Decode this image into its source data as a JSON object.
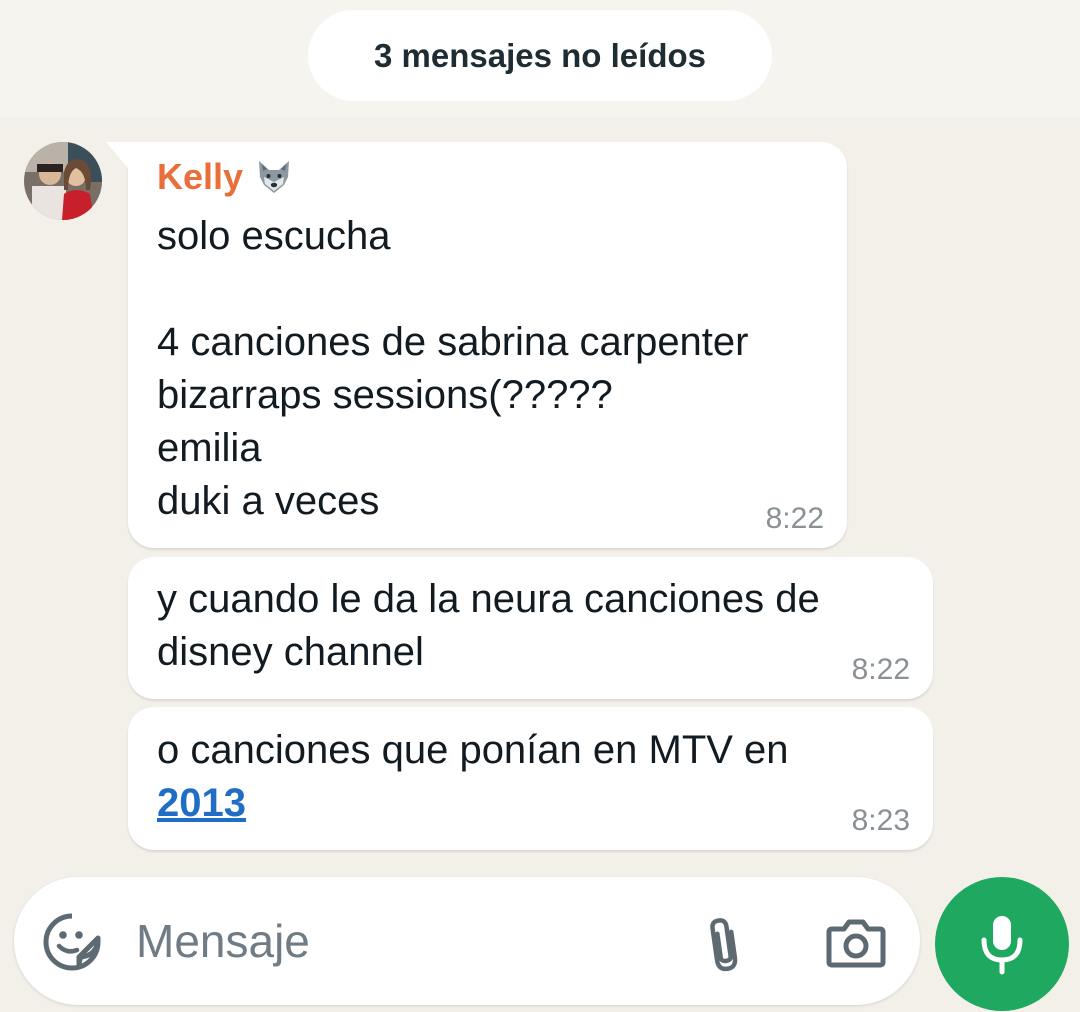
{
  "unread_banner": {
    "text": "3 mensajes no leídos"
  },
  "colors": {
    "chat_background": "#f3f0ea",
    "sender_name": "#e86f3a",
    "link": "#1f6dc4",
    "mic_button": "#1fa85f",
    "bubble": "#ffffff"
  },
  "messages": [
    {
      "sender": "Kelly",
      "sender_emoji": "wolf-icon",
      "text": "solo escucha\n\n4 canciones de sabrina carpenter\nbizarraps sessions(?????\nemilia\nduki a veces",
      "time": "8:22"
    },
    {
      "text": "y cuando le da la neura canciones de\ndisney channel",
      "time": "8:22"
    },
    {
      "text": "o canciones que ponían en MTV en\n",
      "link": "2013",
      "time": "8:23"
    }
  ],
  "composer": {
    "placeholder": "Mensaje",
    "icons": [
      "sticker-icon",
      "paperclip-icon",
      "camera-icon",
      "microphone-icon"
    ]
  }
}
